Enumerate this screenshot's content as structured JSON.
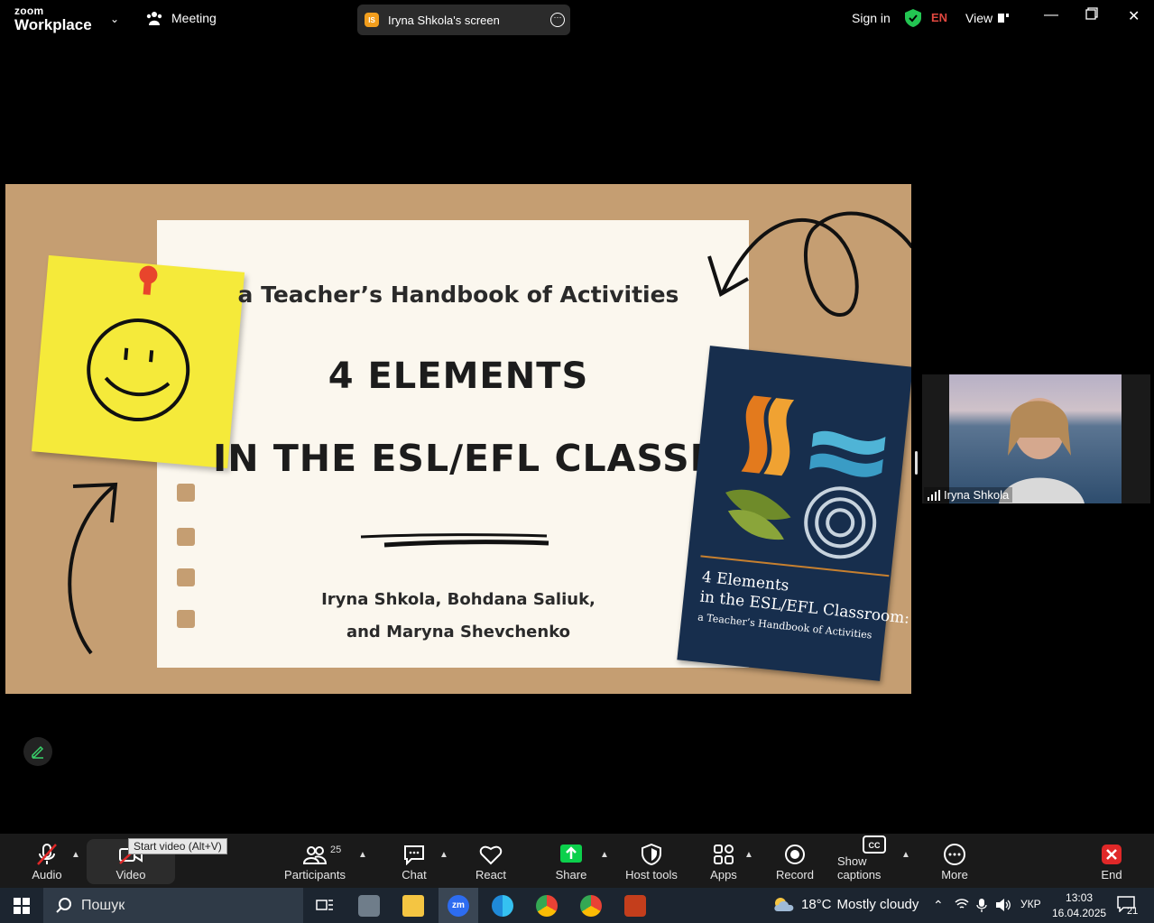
{
  "topbar": {
    "logo_small": "zoom",
    "logo_large": "Workplace",
    "meeting_label": "Meeting",
    "screen_share": {
      "initials": "IS",
      "label": "Iryna Shkola's screen"
    },
    "sign_in": "Sign in",
    "language": "EN",
    "view_label": "View"
  },
  "slide": {
    "subtitle": "a Teacher’s Handbook of Activities",
    "title_line1": "4 ELEMENTS",
    "title_line2": "IN THE ESL/EFL CLASSROOM",
    "authors_line1": "Iryna Shkola, Bohdana Saliuk,",
    "authors_line2": "and Maryna Shevchenko",
    "book": {
      "title_line1": "4 Elements",
      "title_line2": "in the ESL/EFL Classroom:",
      "subtitle": "a Teacher’s Handbook of Activities"
    }
  },
  "participant": {
    "name": "Iryna Shkola"
  },
  "toolbar": {
    "audio": "Audio",
    "video": "Video",
    "video_tooltip": "Start video (Alt+V)",
    "participants": "Participants",
    "participants_count": "25",
    "chat": "Chat",
    "react": "React",
    "share": "Share",
    "host_tools": "Host tools",
    "apps": "Apps",
    "record": "Record",
    "captions": "Show captions",
    "more": "More",
    "end": "End"
  },
  "taskbar": {
    "search_placeholder": "Пошук",
    "weather_temp": "18°C",
    "weather_desc": "Mostly cloudy",
    "keyboard_lang": "УКР",
    "time": "13:03",
    "date": "16.04.2025",
    "notification_count": "21"
  },
  "colors": {
    "share_green": "#0cd04c",
    "end_red": "#e02828",
    "shield_green": "#23c552",
    "cork": "#c59e72",
    "book_navy": "#172e4d"
  }
}
